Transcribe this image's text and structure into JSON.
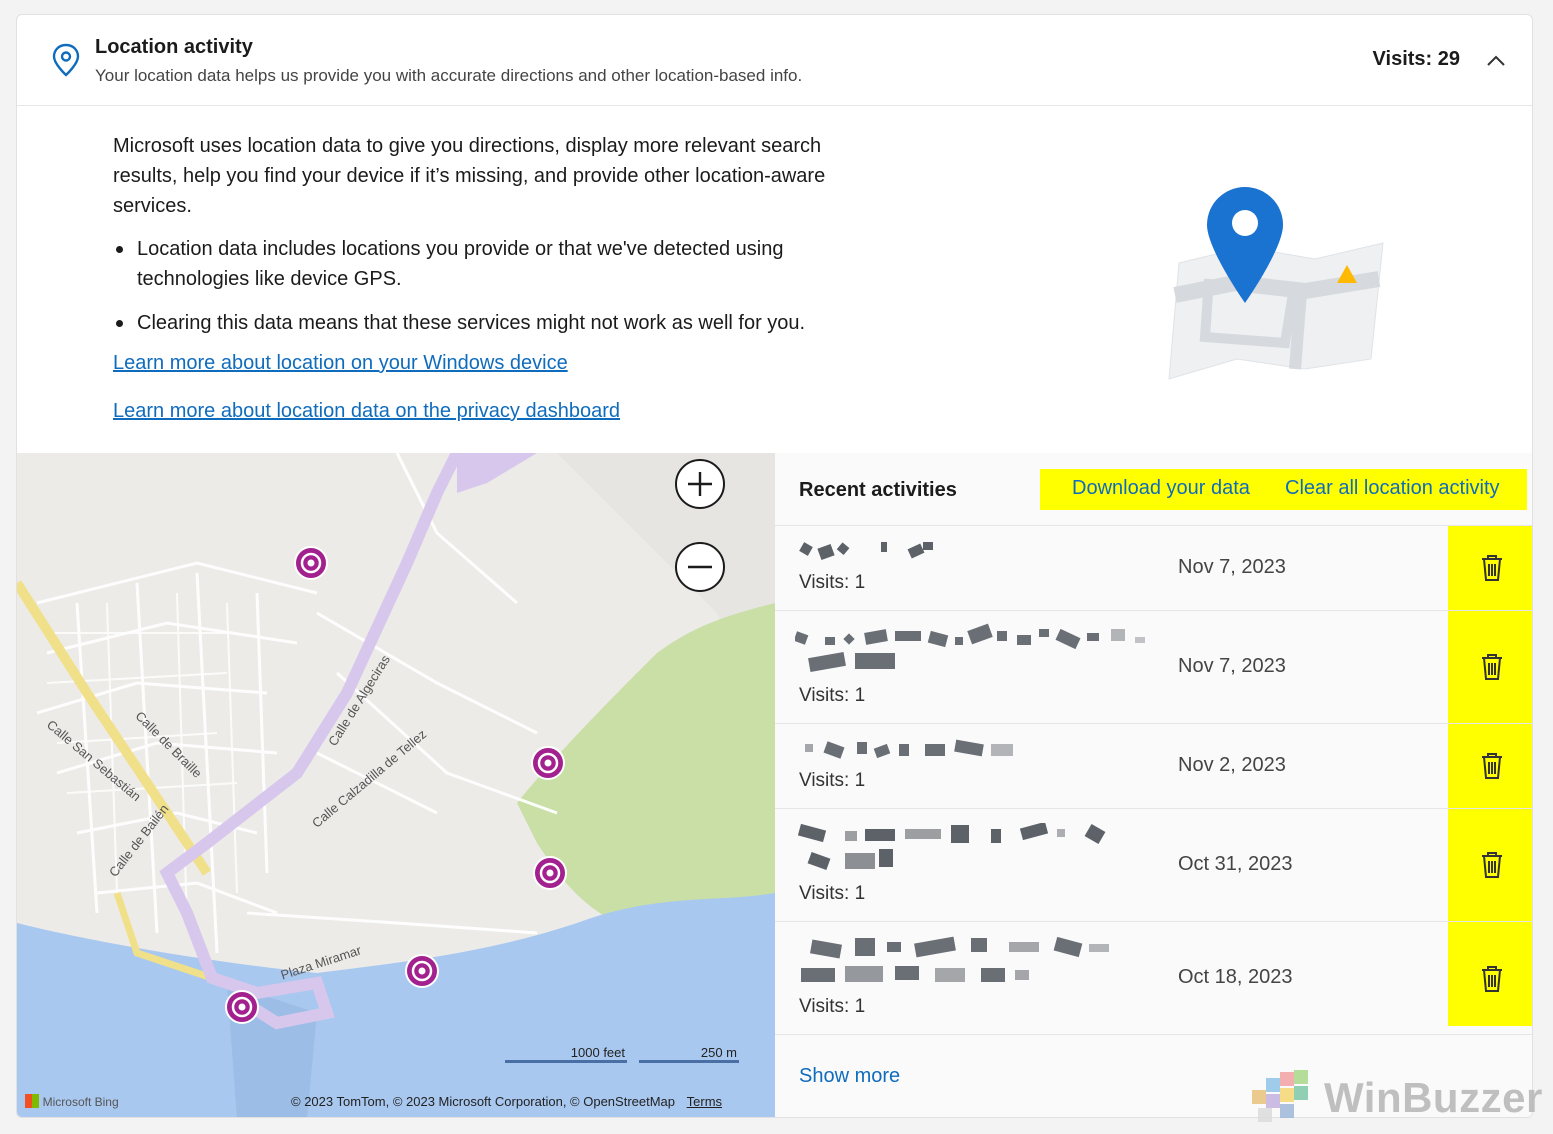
{
  "header": {
    "title": "Location activity",
    "subtitle": "Your location data helps us provide you with accurate directions and other location-based info.",
    "visits": "Visits: 29"
  },
  "intro": {
    "paragraph": "Microsoft uses location data to give you directions, display more relevant search results, help you find your device if it’s missing, and provide other location-aware services.",
    "bullets": [
      "Location data includes locations you provide or that we've detected using technologies like device GPS.",
      "Clearing this data means that these services might not work as well for you."
    ],
    "links": [
      "Learn more about location on your Windows device",
      "Learn more about location data on the privacy dashboard"
    ]
  },
  "map": {
    "streets": [
      "Calle San Sebastián",
      "Calle de Braille",
      "Calle de Bailén",
      "Calle de Algeciras",
      "Calle Calzadilla de Tellez",
      "Plaza Miramar"
    ],
    "scale": [
      "1000 feet",
      "250 m"
    ],
    "brand": "Microsoft Bing",
    "copyright": "© 2023 TomTom, © 2023 Microsoft Corporation, © OpenStreetMap",
    "terms": "Terms"
  },
  "recent": {
    "title": "Recent activities",
    "download_label": "Download your data",
    "clear_label": "Clear all location activity",
    "items": [
      {
        "visits": "Visits: 1",
        "date": "Nov 7, 2023"
      },
      {
        "visits": "Visits: 1",
        "date": "Nov 7, 2023"
      },
      {
        "visits": "Visits: 1",
        "date": "Nov 2, 2023"
      },
      {
        "visits": "Visits: 1",
        "date": "Oct 31, 2023"
      },
      {
        "visits": "Visits: 1",
        "date": "Oct 18, 2023"
      }
    ],
    "show_more": "Show more"
  },
  "watermark": "WinBuzzer",
  "colors": {
    "link": "#0f6cbd",
    "highlight": "#ffff00",
    "pin": "#a3218e",
    "accent": "#1a73d1"
  }
}
